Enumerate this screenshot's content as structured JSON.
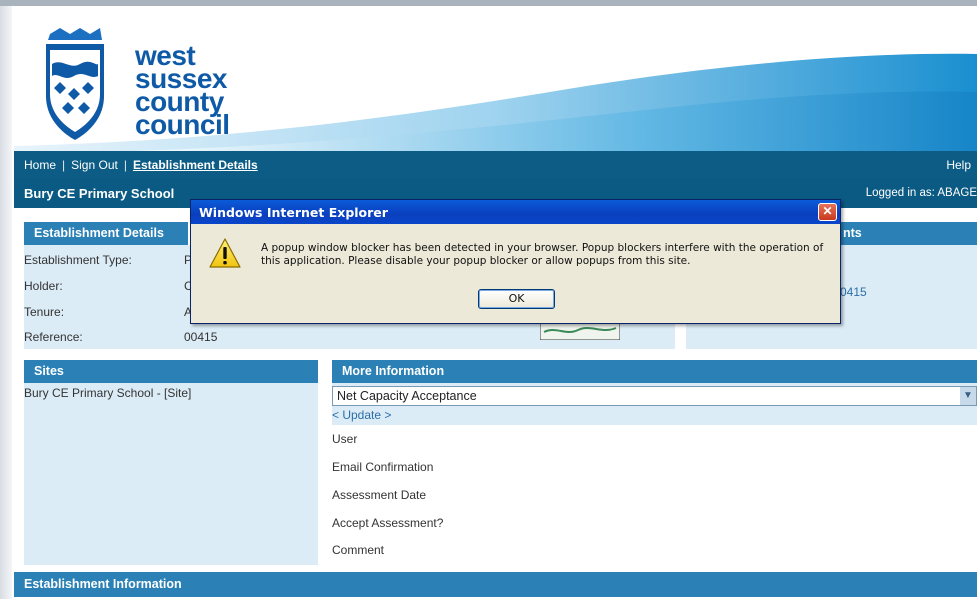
{
  "header": {
    "logo": {
      "line1": "west",
      "line2": "sussex",
      "line3": "county",
      "line4": "council"
    }
  },
  "nav": {
    "home": "Home",
    "sign_out": "Sign Out",
    "establishment_details": "Establishment Details",
    "separator": "|",
    "help": "Help"
  },
  "school": {
    "name": "Bury CE Primary School",
    "logged_in": "Logged in as: ABAGE"
  },
  "establishment": {
    "heading": "Establishment Details",
    "rows": [
      {
        "label": "Establishment Type:",
        "value": "P"
      },
      {
        "label": "Holder:",
        "value": "C"
      },
      {
        "label": "Tenure:",
        "value": "A"
      },
      {
        "label": "Reference:",
        "value": "00415"
      }
    ]
  },
  "right_panel": {
    "heading_fragment": "nts",
    "value_fragment": "0415"
  },
  "sites": {
    "heading": "Sites",
    "items": [
      "Bury CE Primary School - [Site]"
    ]
  },
  "more_info": {
    "heading": "More Information",
    "select_value": "Net Capacity Acceptance",
    "update_link": "< Update >",
    "fields": [
      "User",
      "Email Confirmation",
      "Assessment Date",
      "Accept Assessment?",
      "Comment"
    ]
  },
  "establishment_information": {
    "heading": "Establishment Information"
  },
  "dialog": {
    "title": "Windows Internet Explorer",
    "message": "A popup window blocker has been detected in your browser. Popup blockers interfere with the operation of this application. Please disable your popup blocker or allow popups from this site.",
    "ok_label": "OK",
    "close_glyph": "✕"
  },
  "colors": {
    "nav_bg": "#0c5c85",
    "panel_head": "#2b81b6",
    "panel_body": "#dcecf6",
    "logo_blue": "#0f5aa7",
    "dialog_title": "#0a3fbf"
  }
}
